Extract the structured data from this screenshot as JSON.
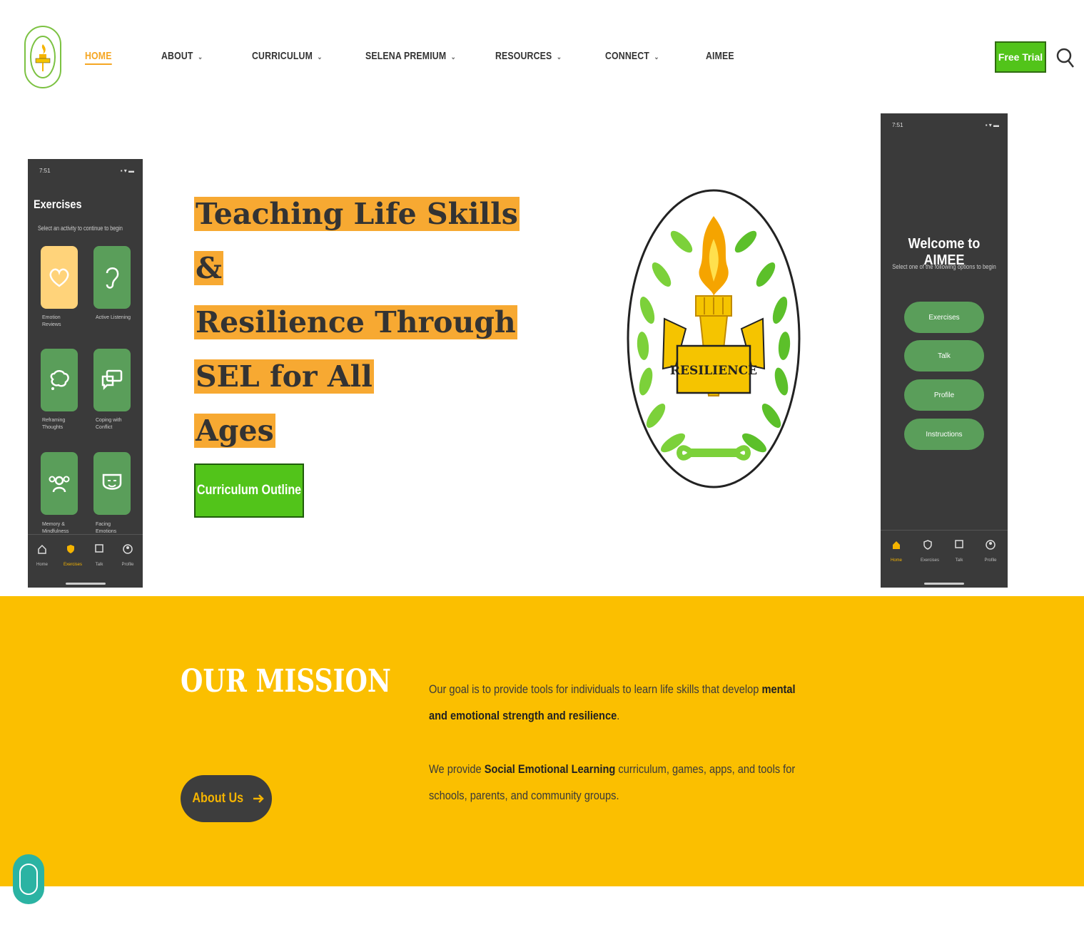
{
  "header": {
    "nav": [
      {
        "label": "HOME",
        "active": true,
        "has_caret": false
      },
      {
        "label": "ABOUT",
        "has_caret": true
      },
      {
        "label": "CURRICULUM",
        "has_caret": true
      },
      {
        "label": "SELENA PREMIUM",
        "has_caret": true
      },
      {
        "label": "RESOURCES",
        "has_caret": true
      },
      {
        "label": "CONNECT",
        "has_caret": true
      },
      {
        "label": "AIMEE",
        "has_caret": false
      }
    ],
    "cta": "Free Trial",
    "caret_glyph": "⌄"
  },
  "left_phone": {
    "time": "7:51",
    "title": "Exercises",
    "subtitle": "Select an activity to continue to begin",
    "tiles": [
      {
        "icon": "heart-icon",
        "label": "Emotion Reviews"
      },
      {
        "icon": "ear-icon",
        "label": "Active Listening"
      },
      {
        "icon": "thought-bubble-icon",
        "label": "Reframing Thoughts"
      },
      {
        "icon": "chat-icon",
        "label": "Coping with Conflict"
      },
      {
        "icon": "people-icon",
        "label": "Memory & Mindfulness"
      },
      {
        "icon": "mask-icon",
        "label": "Facing Emotions"
      }
    ],
    "tabs": [
      "Home",
      "Exercises",
      "Talk",
      "Profile"
    ]
  },
  "right_phone": {
    "time": "7:51",
    "title": "Welcome to AIMEE",
    "subtitle": "Select one of the following options to begin",
    "buttons": [
      "Exercises",
      "Talk",
      "Profile",
      "Instructions"
    ],
    "tabs": [
      "Home",
      "Exercises",
      "Talk",
      "Profile"
    ]
  },
  "hero": {
    "title_lines": [
      "Teaching Life Skills &",
      "Resilience Through SEL for All",
      "Ages"
    ],
    "cta": "Curriculum Outline",
    "emblem_text": "RESILIENCE"
  },
  "mission": {
    "title": "OUR MISSION",
    "button": "About Us",
    "p1_pre": "Our goal is to provide tools for individuals to learn life skills that develop ",
    "p1_bold": "mental and emotional strength and resilience",
    "p1_post": ".",
    "p2_pre": "We provide ",
    "p2_bold": "Social Emotional Learning",
    "p2_post": " curriculum, games, apps, and tools for schools, parents, and community groups."
  },
  "colors": {
    "accent_orange": "#f7a932",
    "green_button": "#52c41a",
    "mission_bg": "#fbbf00",
    "phone_bg": "#3a3a3a",
    "phone_green": "#5a9e5a"
  }
}
